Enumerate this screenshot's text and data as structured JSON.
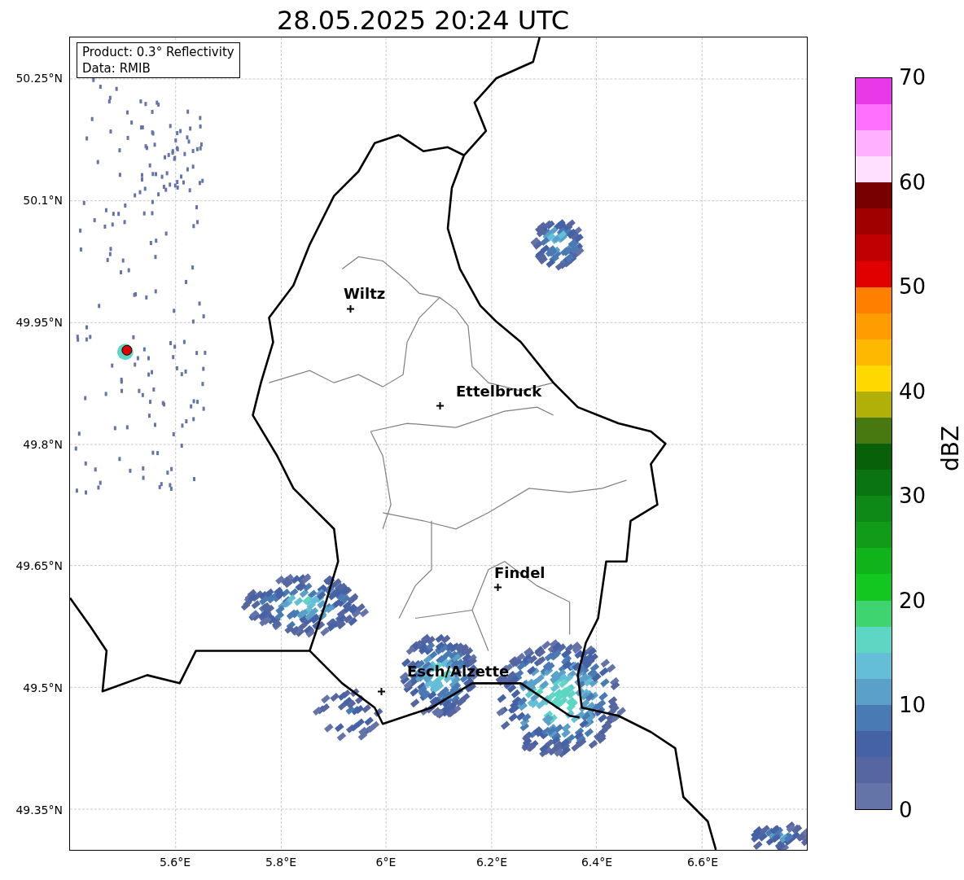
{
  "title": "28.05.2025 20:24 UTC",
  "info_box": {
    "lines": [
      "Product: 0.3° Reflectivity",
      "Data: RMIB"
    ]
  },
  "map": {
    "yticks": [
      "50.25°N",
      "50.1°N",
      "49.95°N",
      "49.8°N",
      "49.65°N",
      "49.5°N",
      "49.35°N"
    ],
    "xticks": [
      "5.6°E",
      "5.8°E",
      "6°E",
      "6.2°E",
      "6.4°E",
      "6.6°E"
    ],
    "places": [
      {
        "name": "Wiltz"
      },
      {
        "name": "Ettelbruck"
      },
      {
        "name": "Findel"
      },
      {
        "name": "Esch/Alzette"
      }
    ]
  },
  "colorbar": {
    "label": "dBZ",
    "ticks": [
      "70",
      "60",
      "50",
      "40",
      "30",
      "20",
      "10",
      "0"
    ],
    "segments": [
      {
        "color": "#e838e8"
      },
      {
        "color": "#ff70ff"
      },
      {
        "color": "#ffb0ff"
      },
      {
        "color": "#ffe0ff"
      },
      {
        "color": "#780000"
      },
      {
        "color": "#a00000"
      },
      {
        "color": "#c00000"
      },
      {
        "color": "#e00000"
      },
      {
        "color": "#ff8000"
      },
      {
        "color": "#ff9c00"
      },
      {
        "color": "#ffb800"
      },
      {
        "color": "#ffd800"
      },
      {
        "color": "#b0b008"
      },
      {
        "color": "#487810"
      },
      {
        "color": "#086008"
      },
      {
        "color": "#0a7410"
      },
      {
        "color": "#0e8816"
      },
      {
        "color": "#109c18"
      },
      {
        "color": "#10b41a"
      },
      {
        "color": "#12c820"
      },
      {
        "color": "#3ed470"
      },
      {
        "color": "#5ed6c4"
      },
      {
        "color": "#64bed8"
      },
      {
        "color": "#5aa0c8"
      },
      {
        "color": "#4a7ab4"
      },
      {
        "color": "#4662a6"
      },
      {
        "color": "#5566a0"
      },
      {
        "color": "#6474a8"
      }
    ]
  }
}
